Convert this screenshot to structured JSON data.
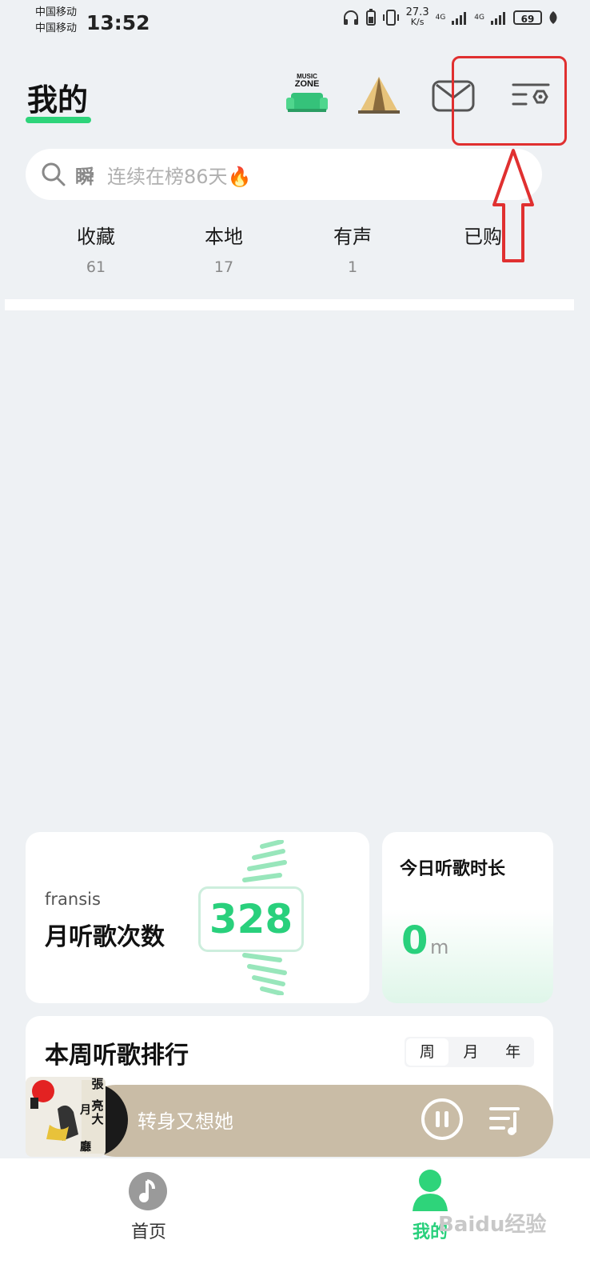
{
  "status_bar": {
    "carrier_1": "中国移动",
    "carrier_2": "中国移动",
    "time": "13:52",
    "net_speed_value": "27.3",
    "net_speed_unit": "K/s",
    "signal_1": "4G",
    "signal_2": "4G",
    "battery": "69"
  },
  "header": {
    "title": "我的",
    "music_zone_text": "MUSIC ZONE",
    "icons": [
      "music-zone-icon",
      "tent-icon",
      "mail-icon",
      "settings-menu-icon"
    ]
  },
  "search": {
    "hot_keyword": "瞬",
    "placeholder": "连续在榜86天🔥"
  },
  "categories": [
    {
      "name": "收藏",
      "count": "61"
    },
    {
      "name": "本地",
      "count": "17"
    },
    {
      "name": "有声",
      "count": "1"
    },
    {
      "name": "已购",
      "count": ""
    }
  ],
  "monthly_card": {
    "username": "fransis",
    "label": "月听歌次数",
    "count": "328"
  },
  "today_card": {
    "label": "今日听歌时长",
    "value": "0",
    "unit": "m"
  },
  "weekly_rank": {
    "title": "本周听歌排行",
    "tabs": [
      "周",
      "月",
      "年"
    ],
    "active_tab": "周"
  },
  "player": {
    "song": "转身又想她",
    "cover_text": [
      "張",
      "亮",
      "大",
      "月",
      "廳"
    ]
  },
  "bottom_nav": {
    "items": [
      {
        "label": "首页",
        "active": false
      },
      {
        "label": "我的",
        "active": true
      }
    ]
  },
  "watermark": "Baidu经验",
  "colors": {
    "accent": "#29d07c",
    "background": "#eef1f4",
    "player_bar": "#c9bca6",
    "annotation": "#e03030"
  }
}
